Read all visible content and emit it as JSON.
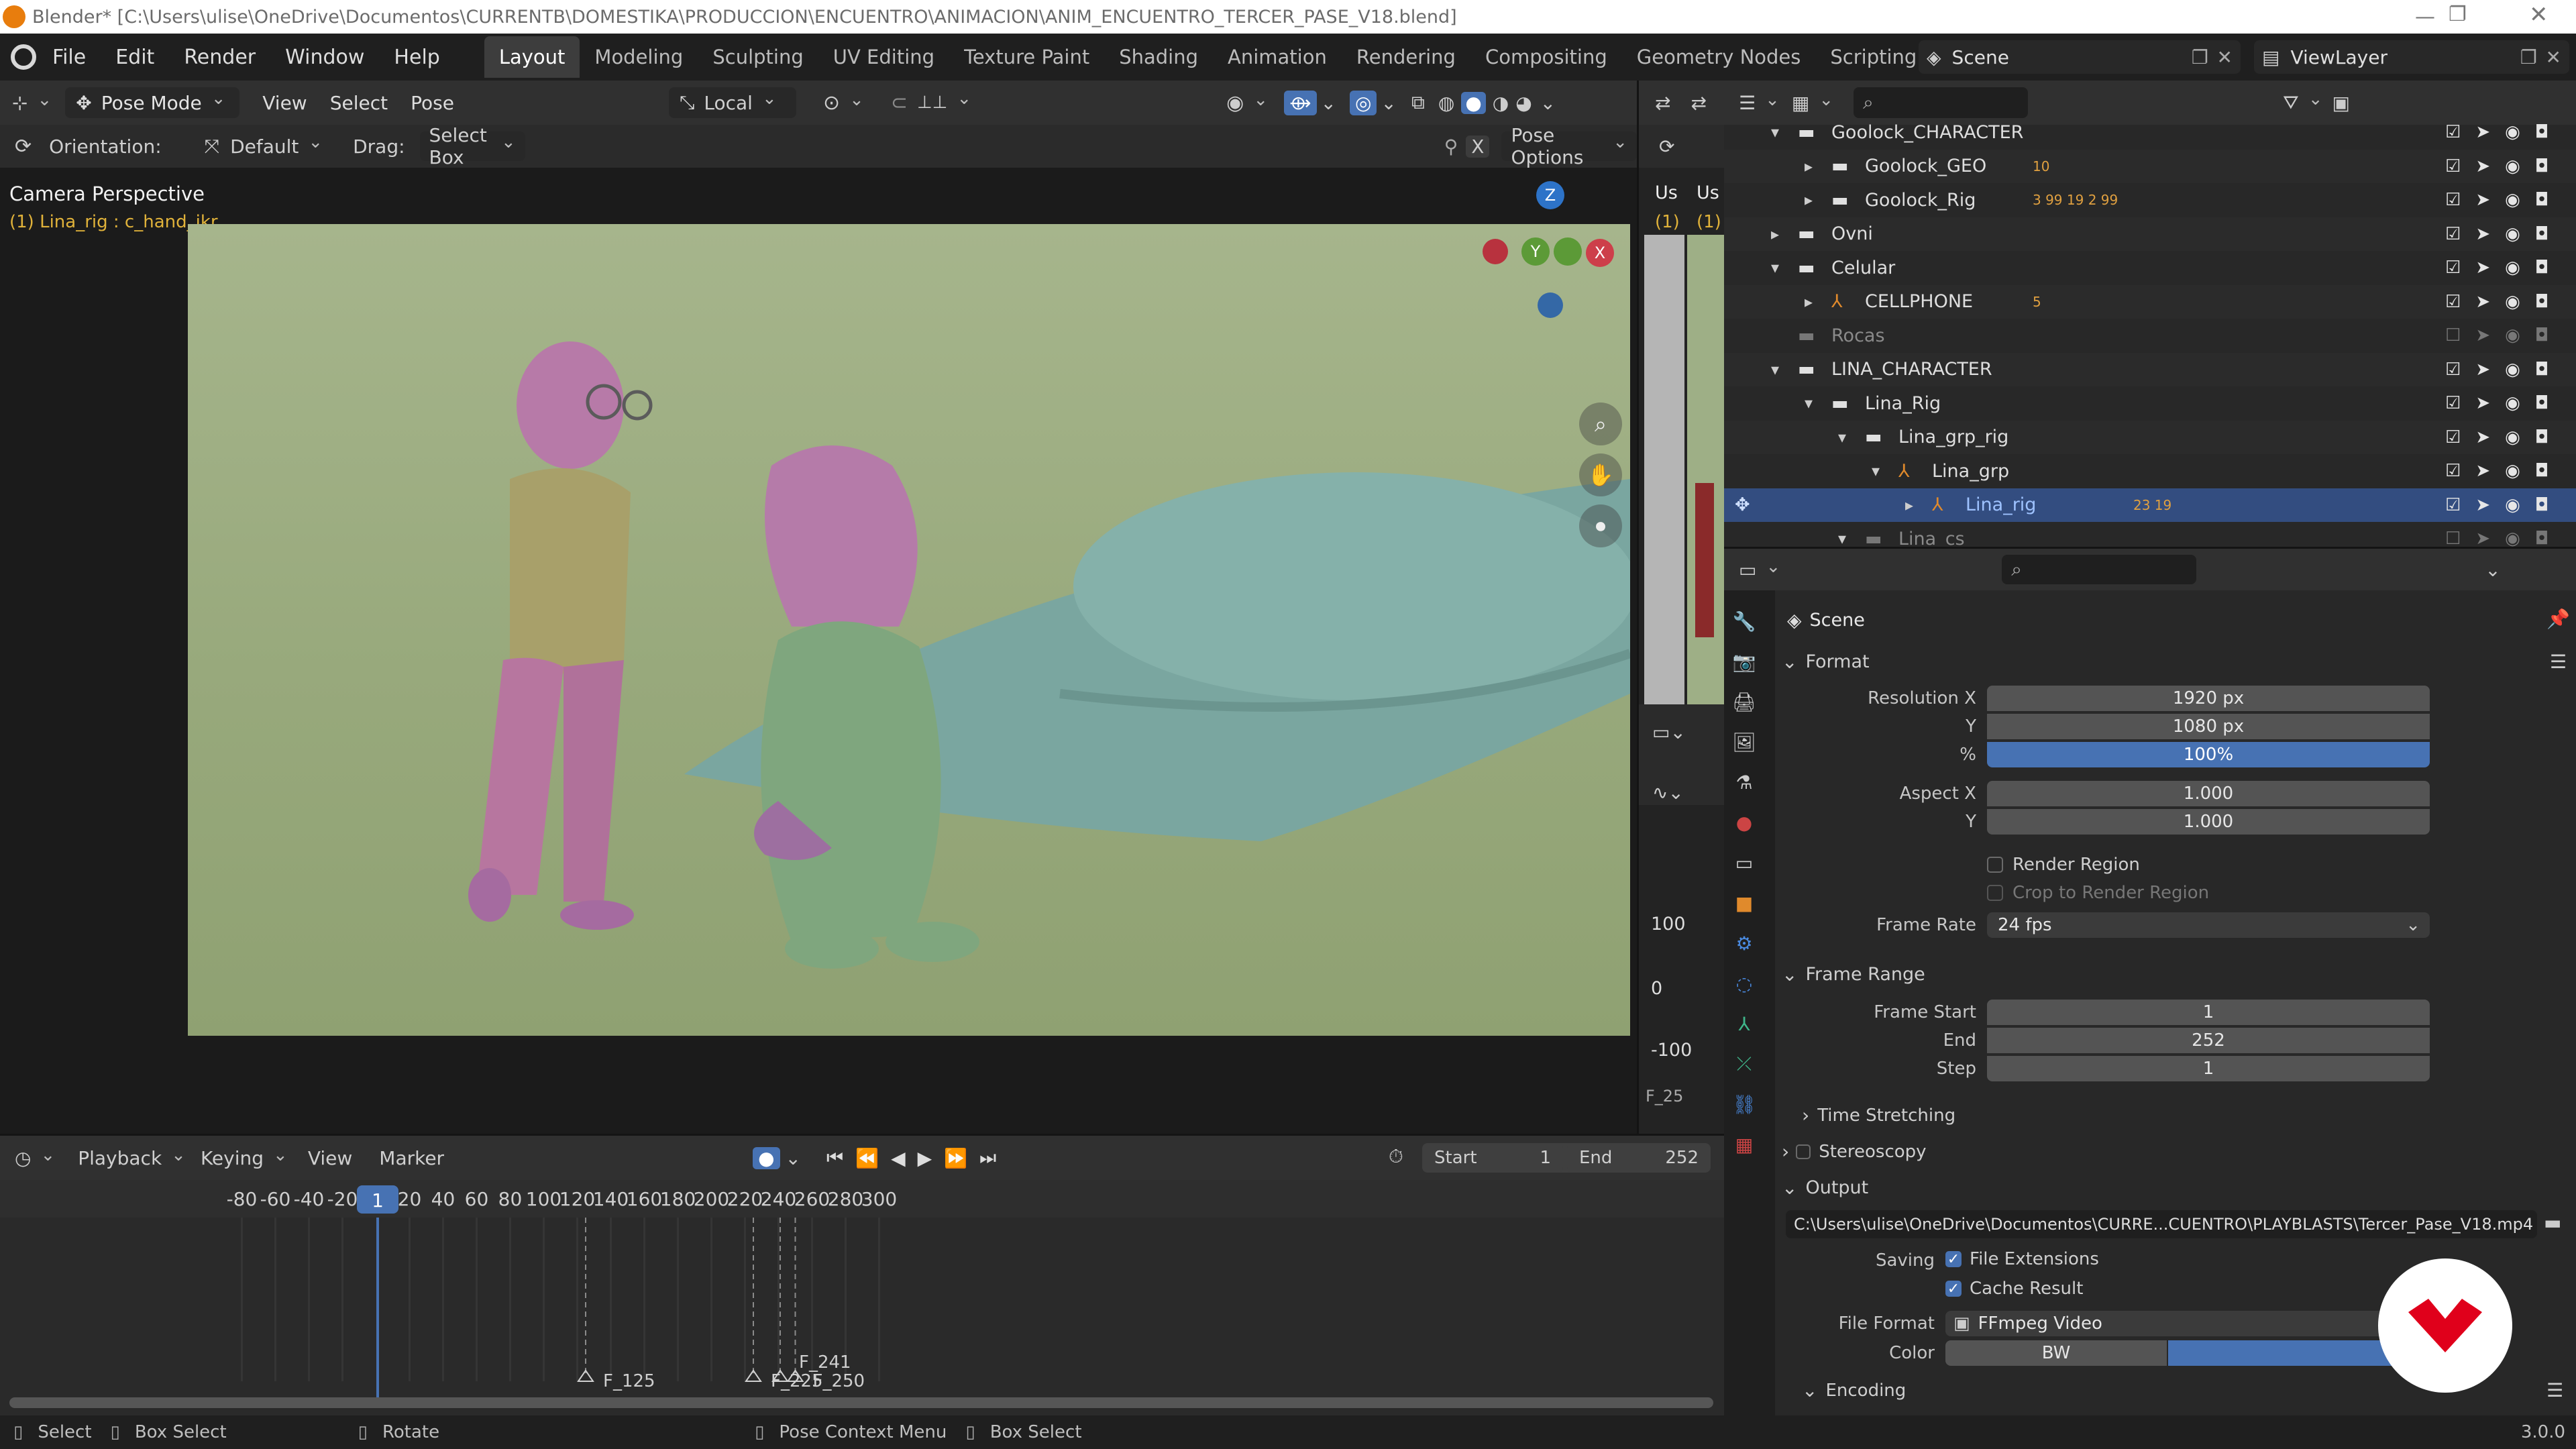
{
  "window": {
    "title": "Blender* [C:\\Users\\ulise\\OneDrive\\Documentos\\CURRENTB\\DOMESTIKA\\PRODUCCION\\ENCUENTRO\\ANIMACION\\ANIM_ENCUENTRO_TERCER_PASE_V18.blend]"
  },
  "menu": [
    "File",
    "Edit",
    "Render",
    "Window",
    "Help"
  ],
  "workspaces": [
    "Layout",
    "Modeling",
    "Sculpting",
    "UV Editing",
    "Texture Paint",
    "Shading",
    "Animation",
    "Rendering",
    "Compositing",
    "Geometry Nodes",
    "Scripting"
  ],
  "active_workspace": "Layout",
  "scene": {
    "name": "Scene",
    "view_layer": "ViewLayer"
  },
  "viewport": {
    "mode": "Pose Mode",
    "menus": [
      "View",
      "Select",
      "Pose"
    ],
    "transform_space": "Local",
    "orientation_label": "Orientation:",
    "orientation_value": "Default",
    "drag_label": "Drag:",
    "drag_value": "Select Box",
    "pose_options": "Pose Options",
    "camera_label": "Camera Perspective",
    "active_object": "(1) Lina_rig : c_hand_ikr",
    "gizmo": {
      "z": "Z",
      "y": "Y",
      "x": "X"
    }
  },
  "side_editor": {
    "us1": "Us",
    "us2": "Us",
    "frame1": "(1)",
    "frame2": "(1)",
    "graph_values": [
      "100",
      "0",
      "-100"
    ],
    "graph_label": "F_25"
  },
  "outliner": {
    "rows": [
      {
        "name": "Goolock_CHARACTER",
        "indent": 0,
        "type": "collection",
        "arrow": "▾"
      },
      {
        "name": "Goolock_GEO",
        "indent": 1,
        "type": "collection",
        "arrow": "▸",
        "extra": "10"
      },
      {
        "name": "Goolock_Rig",
        "indent": 1,
        "type": "collection",
        "arrow": "▸",
        "extra": "3 99 19 2 99"
      },
      {
        "name": "Ovni",
        "indent": 0,
        "type": "collection",
        "arrow": "▸"
      },
      {
        "name": "Celular",
        "indent": 0,
        "type": "collection",
        "arrow": "▾"
      },
      {
        "name": "CELLPHONE",
        "indent": 1,
        "type": "armature",
        "arrow": "▸",
        "extra": "5"
      },
      {
        "name": "Rocas",
        "indent": 0,
        "type": "collection-dim",
        "arrow": ""
      },
      {
        "name": "LINA_CHARACTER",
        "indent": 0,
        "type": "collection",
        "arrow": "▾"
      },
      {
        "name": "Lina_Rig",
        "indent": 1,
        "type": "collection",
        "arrow": "▾"
      },
      {
        "name": "Lina_grp_rig",
        "indent": 2,
        "type": "collection",
        "arrow": "▾"
      },
      {
        "name": "Lina_grp",
        "indent": 3,
        "type": "armature",
        "arrow": "▾"
      },
      {
        "name": "Lina_rig",
        "indent": 4,
        "type": "armature-active",
        "arrow": "▸",
        "extra": "23 19"
      },
      {
        "name": "Lina_cs",
        "indent": 2,
        "type": "collection-dim",
        "arrow": "▾"
      }
    ]
  },
  "properties": {
    "context": "Scene",
    "format": {
      "header": "Format",
      "resolution_x_label": "Resolution X",
      "resolution_x": "1920 px",
      "resolution_y_label": "Y",
      "resolution_y": "1080 px",
      "percent_label": "%",
      "percent": "100%",
      "aspect_x_label": "Aspect X",
      "aspect_x": "1.000",
      "aspect_y_label": "Y",
      "aspect_y": "1.000",
      "render_region": "Render Region",
      "crop_region": "Crop to Render Region",
      "frame_rate_label": "Frame Rate",
      "frame_rate": "24 fps"
    },
    "frame_range": {
      "header": "Frame Range",
      "start_label": "Frame Start",
      "start": "1",
      "end_label": "End",
      "end": "252",
      "step_label": "Step",
      "step": "1"
    },
    "time_stretching": "Time Stretching",
    "stereoscopy": "Stereoscopy",
    "output": {
      "header": "Output",
      "path": "C:\\Users\\ulise\\OneDrive\\Documentos\\CURRE...CUENTRO\\PLAYBLASTS\\Tercer_Pase_V18.mp4",
      "saving_label": "Saving",
      "file_extensions": "File Extensions",
      "cache_result": "Cache Result",
      "file_format_label": "File Format",
      "file_format": "FFmpeg Video",
      "color_label": "Color",
      "color_bw": "BW"
    },
    "encoding": "Encoding"
  },
  "timeline": {
    "menus": [
      "Playback",
      "Keying",
      "View",
      "Marker"
    ],
    "current_frame": "1",
    "start_label": "Start",
    "start": "1",
    "end_label": "End",
    "end": "252",
    "ruler": [
      "-80",
      "-60",
      "-40",
      "-20",
      "1",
      "20",
      "40",
      "60",
      "80",
      "100",
      "120",
      "140",
      "160",
      "180",
      "200",
      "220",
      "240",
      "260",
      "280",
      "300"
    ],
    "markers": [
      {
        "label": "F_125",
        "frame": 125
      },
      {
        "label": "F_225",
        "frame": 225
      },
      {
        "label": "F_241",
        "frame": 241
      },
      {
        "label": "F_250",
        "frame": 250
      }
    ]
  },
  "statusbar": {
    "items": [
      "Select",
      "Box Select",
      "Rotate",
      "Pose Context Menu",
      "Box Select"
    ],
    "version": "3.0.0"
  },
  "colors": {
    "accent": "#4772b3",
    "viewport_bg": "#9eaf86",
    "header_bg": "#303030",
    "selected_row": "#334d80",
    "domestika_red": "#e0001b"
  }
}
